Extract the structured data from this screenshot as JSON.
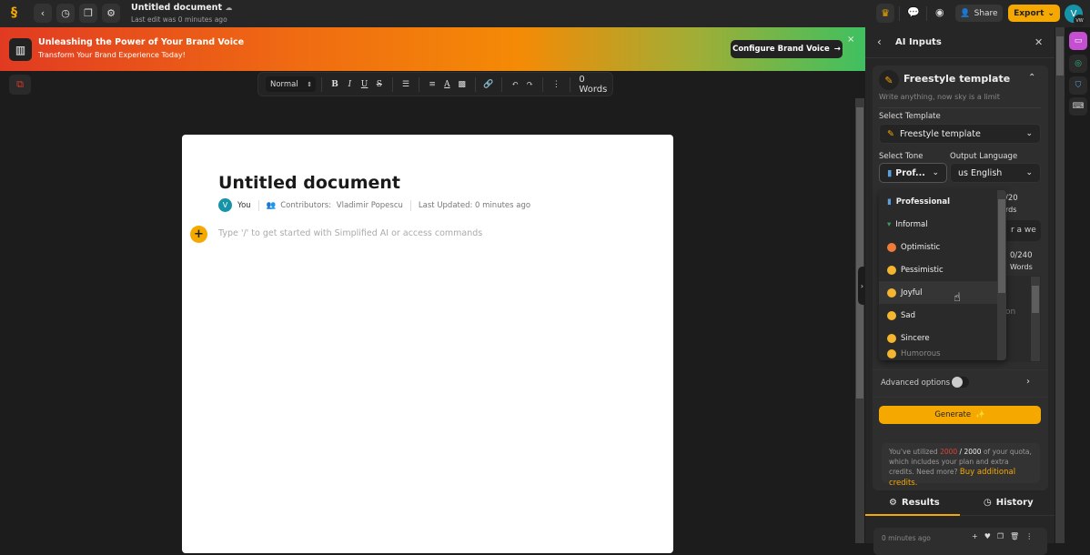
{
  "topbar": {
    "title": "Untitled document",
    "subtitle": "Last edit was 0 minutes ago",
    "share_label": "Share",
    "export_label": "Export",
    "avatar_initial": "V",
    "avatar_badge": "VW"
  },
  "banner": {
    "title": "Unleashing the Power of Your Brand Voice",
    "subtitle": "Transform Your Brand Experience Today!",
    "cta_label": "Configure Brand Voice",
    "close_label": "×"
  },
  "toolbar": {
    "format_value": "Normal",
    "word_count": "0 Words"
  },
  "document": {
    "title": "Untitled document",
    "author_initial": "V",
    "author_label": "You",
    "contributors_label": "Contributors:",
    "contributors_value": "Vladimir Popescu",
    "last_updated": "Last Updated: 0 minutes ago",
    "placeholder": "Type '/' to get started with Simplified AI or access commands"
  },
  "panel": {
    "title": "AI Inputs",
    "template_heading": "Freestyle template",
    "template_desc": "Write anything, now sky is a limit",
    "select_template_label": "Select Template",
    "select_template_value": "Freestyle template",
    "select_tone_label": "Select Tone",
    "select_tone_value": "Prof...",
    "output_language_label": "Output Language",
    "output_language_value": "us English",
    "counter_1": "/20",
    "counter_1_unit": "rds",
    "field_hint": "r a we",
    "counter_2": "0/240",
    "counter_2_unit": "Words",
    "field_hint_2": "on",
    "advanced_label": "Advanced options",
    "generate_label": "Generate",
    "quota": {
      "prefix": "You've utilized",
      "used": "2000",
      "sep": " / ",
      "total": "2000",
      "suffix": "of your quota, which includes your plan and extra credits. Need more?",
      "link": "Buy additional credits."
    },
    "tabs": [
      {
        "label": "Results",
        "active": true
      },
      {
        "label": "History",
        "active": false
      }
    ],
    "result_time": "0 minutes ago"
  },
  "tone_options": [
    {
      "label": "Professional",
      "icon": "jeans-icon"
    },
    {
      "label": "Informal",
      "icon": "tshirt-icon"
    },
    {
      "label": "Optimistic",
      "icon": "star-eyes-emoji-icon"
    },
    {
      "label": "Pessimistic",
      "icon": "rolling-eyes-emoji-icon"
    },
    {
      "label": "Joyful",
      "icon": "laughing-emoji-icon",
      "hovered": true
    },
    {
      "label": "Sad",
      "icon": "sad-emoji-icon"
    },
    {
      "label": "Sincere",
      "icon": "smile-emoji-icon"
    },
    {
      "label": "Humorous",
      "icon": "emoji-icon"
    }
  ],
  "colors": {
    "accent": "#f5a800",
    "quota_used": "#e0403a",
    "avatar": "#1793a8",
    "rail_primary": "#c44fd0"
  }
}
